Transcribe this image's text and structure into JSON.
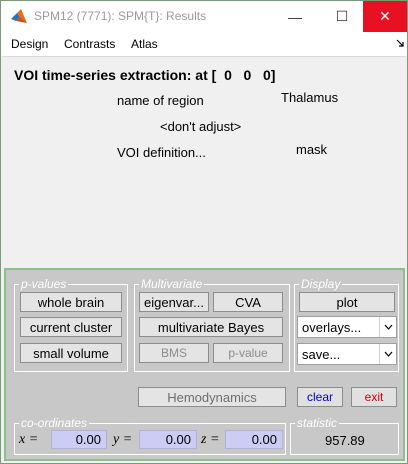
{
  "window": {
    "title": "SPM12 (7771): SPM{T}: Results",
    "app_icon": "matlab-icon",
    "controls": {
      "minimize": "—",
      "maximize": "☐",
      "close": "✕"
    }
  },
  "menubar": {
    "items": [
      "Design",
      "Contrasts",
      "Atlas"
    ],
    "overflow_icon": "chevron-icon"
  },
  "dialog": {
    "title": "VOI time-series extraction: at [  0   0   0]",
    "rows": [
      {
        "label": "name of region",
        "value": "Thalamus"
      },
      {
        "label": "<don't adjust>",
        "value": ""
      },
      {
        "label": "VOI definition...",
        "value": "mask"
      }
    ]
  },
  "panel": {
    "pvalues": {
      "title": "p-values",
      "buttons": [
        "whole brain",
        "current cluster",
        "small volume"
      ]
    },
    "multivariate": {
      "title": "Multivariate",
      "eigenvariate": "eigenvar...",
      "cva": "CVA",
      "multivariate_bayes": "multivariate Bayes",
      "bms": "BMS",
      "pvalue": "p-value"
    },
    "display": {
      "title": "Display",
      "plot": "plot",
      "overlays": "overlays...",
      "save": "save..."
    },
    "hemodynamics": "Hemodynamics",
    "clear": "clear",
    "exit": "exit",
    "coordinates": {
      "title": "co-ordinates",
      "x_label": "x =",
      "x": "0.00",
      "y_label": "y =",
      "y": "0.00",
      "z_label": "z =",
      "z": "0.00"
    },
    "statistic": {
      "title": "statistic",
      "value": "957.89"
    }
  },
  "colors": {
    "close_button": "#e81123",
    "panel_bg": "#c8c8c8",
    "panel_border": "#8cbf8c",
    "coord_field": "#ccccf5",
    "exit_text": "#d40000",
    "clear_text": "#0000e0"
  }
}
